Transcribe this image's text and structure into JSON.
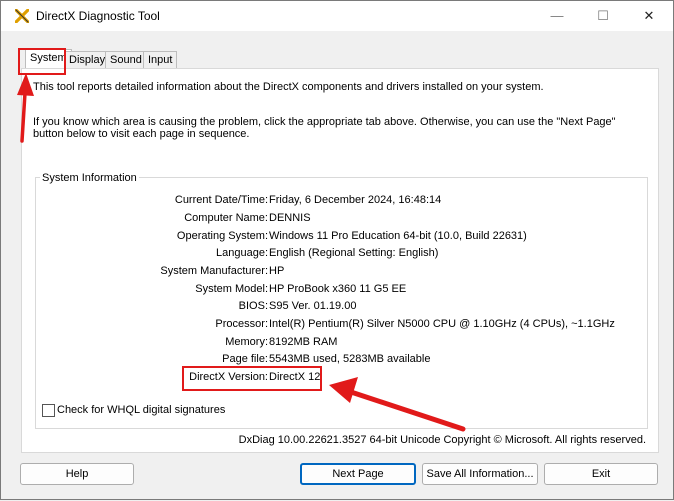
{
  "window": {
    "title": "DirectX Diagnostic Tool"
  },
  "tabs": [
    {
      "label": "System"
    },
    {
      "label": "Display"
    },
    {
      "label": "Sound"
    },
    {
      "label": "Input"
    }
  ],
  "intro": {
    "line1": "This tool reports detailed information about the DirectX components and drivers installed on your system.",
    "line2": "If you know which area is causing the problem, click the appropriate tab above.  Otherwise, you can use the \"Next Page\" button below to visit each page in sequence."
  },
  "system_info": {
    "title": "System Information",
    "rows": [
      {
        "label": "Current Date/Time:",
        "value": "Friday, 6 December 2024, 16:48:14"
      },
      {
        "label": "Computer Name:",
        "value": "DENNIS"
      },
      {
        "label": "Operating System:",
        "value": "Windows 11 Pro Education 64-bit (10.0, Build 22631)"
      },
      {
        "label": "Language:",
        "value": "English (Regional Setting: English)"
      },
      {
        "label": "System Manufacturer:",
        "value": "HP"
      },
      {
        "label": "System Model:",
        "value": "HP ProBook x360 11 G5 EE"
      },
      {
        "label": "BIOS:",
        "value": "S95 Ver. 01.19.00"
      },
      {
        "label": "Processor:",
        "value": "Intel(R) Pentium(R) Silver N5000 CPU @ 1.10GHz (4 CPUs), ~1.1GHz"
      },
      {
        "label": "Memory:",
        "value": "8192MB RAM"
      },
      {
        "label": "Page file:",
        "value": "5543MB used, 5283MB available"
      },
      {
        "label": "DirectX Version:",
        "value": "DirectX 12"
      }
    ]
  },
  "whql": {
    "label": "Check for WHQL digital signatures",
    "checked": false
  },
  "footer": {
    "copyright": "DxDiag 10.00.22621.3527 64-bit Unicode  Copyright © Microsoft. All rights reserved."
  },
  "buttons": {
    "help": "Help",
    "next_page": "Next Page",
    "save_all": "Save All Information...",
    "exit": "Exit"
  },
  "colors": {
    "annotation_red": "#e11a1a",
    "accent_blue": "#0067c0"
  }
}
